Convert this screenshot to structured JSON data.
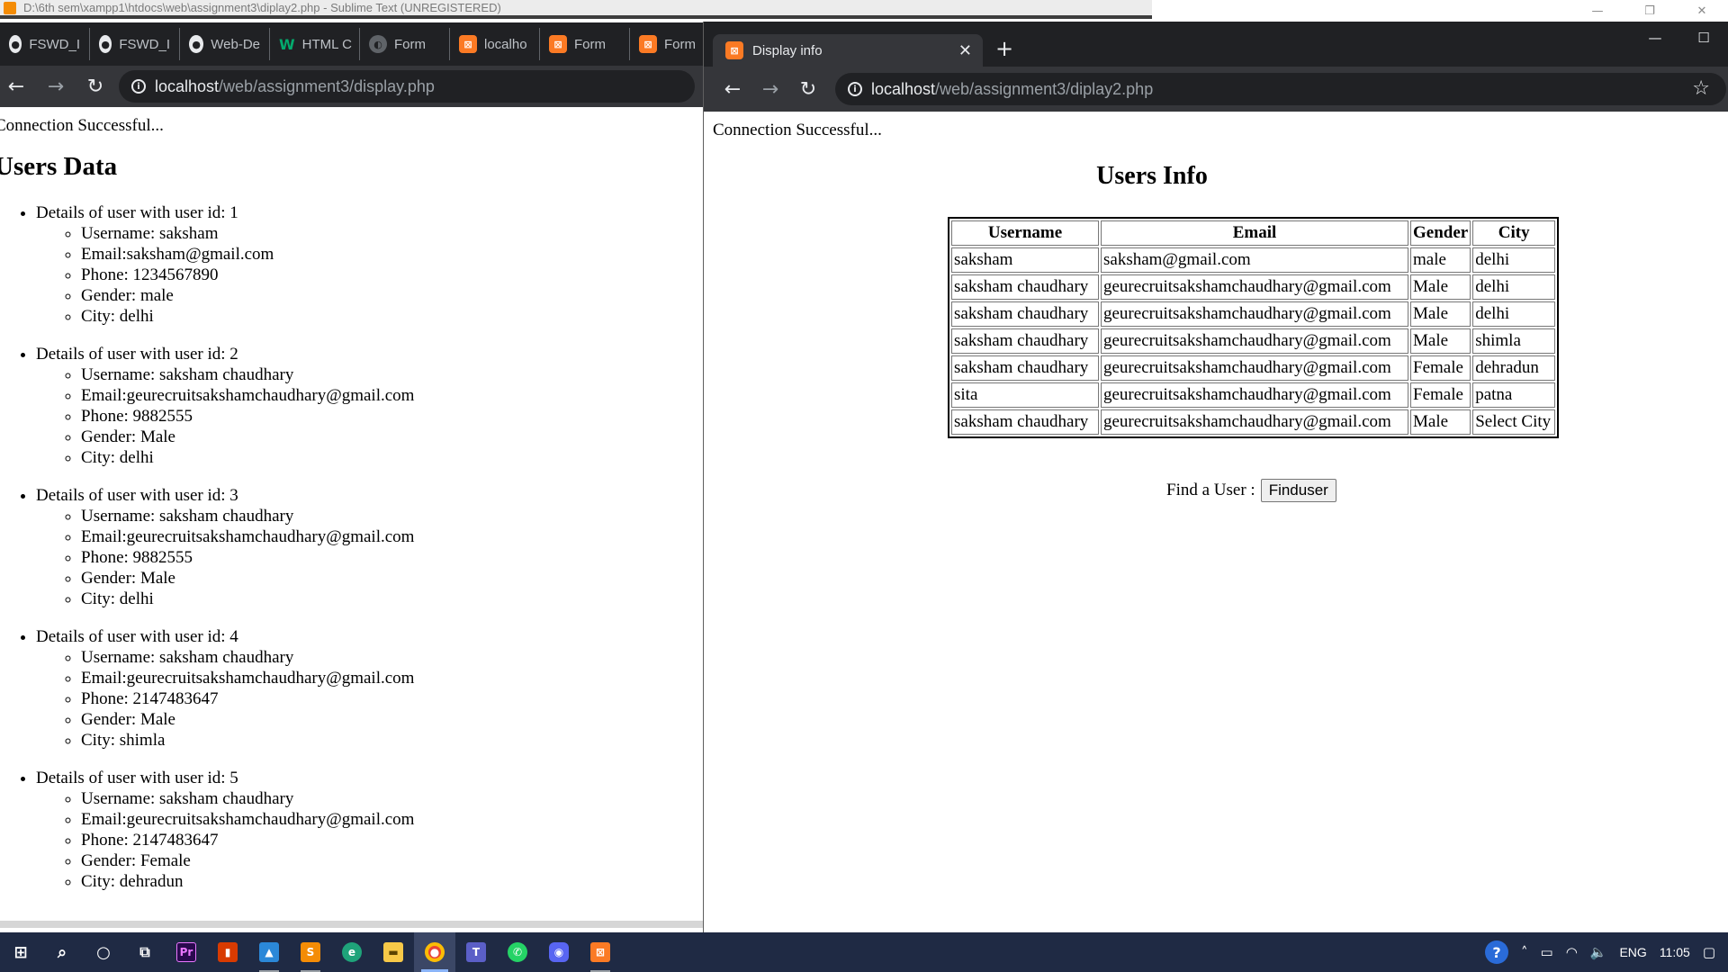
{
  "sublime": {
    "title": "D:\\6th sem\\xampp1\\htdocs\\web\\assignment3\\diplay2.php - Sublime Text (UNREGISTERED)"
  },
  "window_controls": {
    "minimize": "—",
    "restore": "❐",
    "close": "✕"
  },
  "left_browser": {
    "tabs": [
      {
        "icon": "github-icon",
        "label": "FSWD_I"
      },
      {
        "icon": "github-icon",
        "label": "FSWD_I"
      },
      {
        "icon": "github-icon",
        "label": "Web-De"
      },
      {
        "icon": "w3schools-icon",
        "label": "HTML C"
      },
      {
        "icon": "globe-icon",
        "label": "Form"
      },
      {
        "icon": "xampp-icon",
        "label": "localho"
      },
      {
        "icon": "xampp-icon",
        "label": "Form"
      },
      {
        "icon": "xampp-icon",
        "label": "Form"
      }
    ],
    "url_host": "localhost",
    "url_path": "/web/assignment3/display.php",
    "page": {
      "connection": "Connection Successful...",
      "heading": "Users Data",
      "users": [
        {
          "header": "Details of user with user id: 1",
          "username": "Username: saksham",
          "email": "Email:saksham@gmail.com",
          "phone": "Phone: 1234567890",
          "gender": "Gender: male",
          "city": "City: delhi"
        },
        {
          "header": "Details of user with user id: 2",
          "username": "Username: saksham chaudhary",
          "email": "Email:geurecruitsakshamchaudhary@gmail.com",
          "phone": "Phone: 9882555",
          "gender": "Gender: Male",
          "city": "City: delhi"
        },
        {
          "header": "Details of user with user id: 3",
          "username": "Username: saksham chaudhary",
          "email": "Email:geurecruitsakshamchaudhary@gmail.com",
          "phone": "Phone: 9882555",
          "gender": "Gender: Male",
          "city": "City: delhi"
        },
        {
          "header": "Details of user with user id: 4",
          "username": "Username: saksham chaudhary",
          "email": "Email:geurecruitsakshamchaudhary@gmail.com",
          "phone": "Phone: 2147483647",
          "gender": "Gender: Male",
          "city": "City: shimla"
        },
        {
          "header": "Details of user with user id: 5",
          "username": "Username: saksham chaudhary",
          "email": "Email:geurecruitsakshamchaudhary@gmail.com",
          "phone": "Phone: 2147483647",
          "gender": "Gender: Female",
          "city": "City: dehradun"
        }
      ]
    }
  },
  "right_browser": {
    "tab_title": "Display info",
    "url_host": "localhost",
    "url_path": "/web/assignment3/diplay2.php",
    "page": {
      "connection": "Connection Successful...",
      "heading": "Users Info",
      "table": {
        "headers": [
          "Username",
          "Email",
          "Gender",
          "City"
        ],
        "rows": [
          [
            "saksham",
            "saksham@gmail.com",
            "male",
            "delhi"
          ],
          [
            "saksham chaudhary",
            "geurecruitsakshamchaudhary@gmail.com",
            "Male",
            "delhi"
          ],
          [
            "saksham chaudhary",
            "geurecruitsakshamchaudhary@gmail.com",
            "Male",
            "delhi"
          ],
          [
            "saksham chaudhary",
            "geurecruitsakshamchaudhary@gmail.com",
            "Male",
            "shimla"
          ],
          [
            "saksham chaudhary",
            "geurecruitsakshamchaudhary@gmail.com",
            "Female",
            "dehradun"
          ],
          [
            "sita",
            "geurecruitsakshamchaudhary@gmail.com",
            "Female",
            "patna"
          ],
          [
            "saksham chaudhary",
            "geurecruitsakshamchaudhary@gmail.com",
            "Male",
            "Select City"
          ]
        ]
      },
      "find_label": "Find a User :",
      "find_button": "Finduser"
    }
  },
  "taskbar": {
    "apps": [
      {
        "name": "windows-start-icon"
      },
      {
        "name": "search-icon"
      },
      {
        "name": "cortana-icon"
      },
      {
        "name": "task-view-icon"
      },
      {
        "name": "premiere-pro-icon",
        "label": "Pr"
      },
      {
        "name": "office-icon"
      },
      {
        "name": "photos-icon"
      },
      {
        "name": "sublime-text-icon"
      },
      {
        "name": "edge-icon"
      },
      {
        "name": "file-explorer-icon"
      },
      {
        "name": "chrome-icon"
      },
      {
        "name": "teams-icon",
        "label": "T"
      },
      {
        "name": "whatsapp-icon"
      },
      {
        "name": "discord-icon"
      },
      {
        "name": "xampp-icon"
      }
    ],
    "tray": {
      "language": "ENG",
      "time": "11:05"
    }
  },
  "colors": {
    "tab_bg": "#202124",
    "toolbar_bg": "#35363a",
    "taskbar_bg": "#1f2a44",
    "xampp": "#fb7a24"
  }
}
